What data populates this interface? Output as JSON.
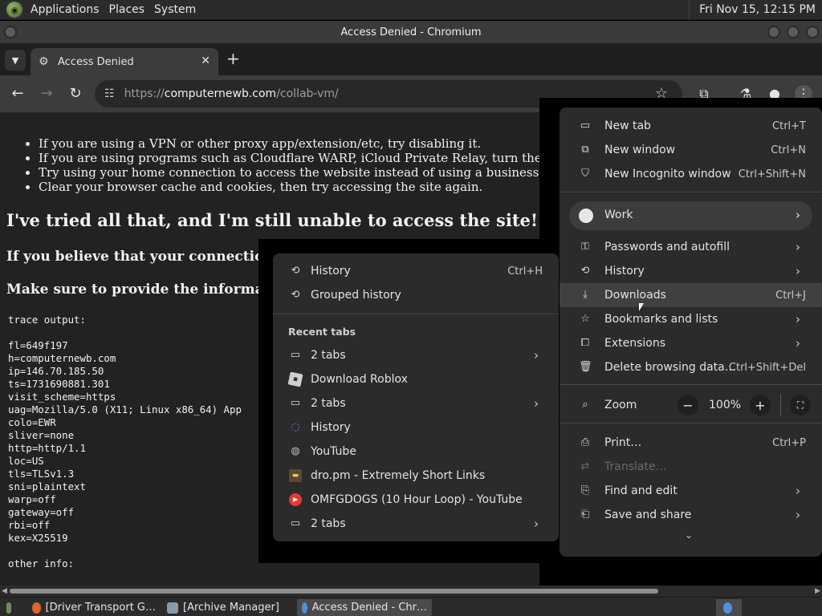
{
  "top_panel": {
    "menus": [
      "Applications",
      "Places",
      "System"
    ],
    "clock": "Fri Nov 15, 12:15 PM"
  },
  "window": {
    "title": "Access Denied - Chromium"
  },
  "tabs": [
    {
      "title": "Access Denied",
      "close": "✕"
    }
  ],
  "new_tab_symbol": "+",
  "toolbar": {
    "url_scheme": "https://",
    "url_host": "computernewb.com",
    "url_path": "/collab-vm/"
  },
  "page": {
    "bullets": [
      "If you are using a VPN or other proxy app/extension/etc, try disabling it.",
      "If you are using programs such as Cloudflare WARP, iCloud Private Relay, turn them off as they c",
      "Try using your home connection to access the website instead of using a business connection or sc",
      "Clear your browser cache and cookies, then try accessing the site again."
    ],
    "heading": "I've tried all that, and I'm still unable to access the site!",
    "subheading1": "If you believe that your connection has t",
    "subheading2": "Make sure to provide the information fo",
    "trace_title": "trace output:",
    "trace_lines": [
      "fl=649f197",
      "h=computernewb.com",
      "ip=146.70.185.50",
      "ts=1731690881.301",
      "visit_scheme=https",
      "uag=Mozilla/5.0 (X11; Linux x86_64) App",
      "colo=EWR",
      "sliver=none",
      "http=http/1.1",
      "loc=US",
      "tls=TLSv1.3",
      "sni=plaintext",
      "warp=off",
      "gateway=off",
      "rbi=off",
      "kex=X25519"
    ],
    "other_info": "other info:"
  },
  "history_submenu": {
    "history": {
      "label": "History",
      "shortcut": "Ctrl+H"
    },
    "grouped_history": "Grouped history",
    "recent_tabs_heading": "Recent tabs",
    "recent": [
      {
        "label": "2 tabs",
        "icon": "window-icon",
        "arrow": true
      },
      {
        "label": "Download Roblox",
        "icon": "roblox-icon"
      },
      {
        "label": "2 tabs",
        "icon": "window-icon",
        "arrow": true
      },
      {
        "label": "History",
        "icon": "chromium-icon"
      },
      {
        "label": "YouTube",
        "icon": "globe-icon"
      },
      {
        "label": "dro.pm - Extremely Short Links",
        "icon": "dro-icon"
      },
      {
        "label": "OMFGDOGS (10 Hour Loop) - YouTube",
        "icon": "youtube-icon"
      },
      {
        "label": "2 tabs",
        "icon": "window-icon",
        "arrow": true
      }
    ]
  },
  "main_menu": {
    "new_tab": {
      "label": "New tab",
      "shortcut": "Ctrl+T"
    },
    "new_window": {
      "label": "New window",
      "shortcut": "Ctrl+N"
    },
    "new_incognito": {
      "label": "New Incognito window",
      "shortcut": "Ctrl+Shift+N"
    },
    "profile": "Work",
    "passwords": "Passwords and autofill",
    "history": "History",
    "downloads": {
      "label": "Downloads",
      "shortcut": "Ctrl+J"
    },
    "bookmarks": "Bookmarks and lists",
    "extensions": "Extensions",
    "delete_data": {
      "label": "Delete browsing data…",
      "shortcut": "Ctrl+Shift+Del"
    },
    "zoom": {
      "label": "Zoom",
      "minus": "−",
      "value": "100%",
      "plus": "+"
    },
    "print": {
      "label": "Print…",
      "shortcut": "Ctrl+P"
    },
    "translate": "Translate…",
    "find_edit": "Find and edit",
    "save_share": "Save and share",
    "more": "⌄"
  },
  "taskbar": {
    "tasks": [
      "[Driver Transport G…",
      "[Archive Manager]",
      "Access Denied - Chr…"
    ]
  },
  "colors": {
    "menu_bg": "#2b2b2b",
    "highlight": "#404040",
    "page_bg": "#222222",
    "youtube_red": "#e53935"
  }
}
